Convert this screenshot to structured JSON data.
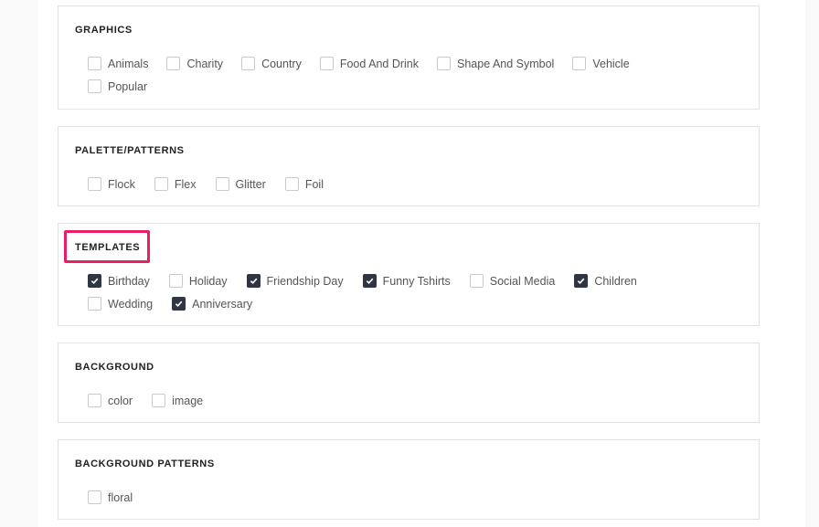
{
  "sections": [
    {
      "title": "GRAPHICS",
      "rows": [
        [
          {
            "label": "Animals",
            "checked": false
          },
          {
            "label": "Charity",
            "checked": false
          },
          {
            "label": "Country",
            "checked": false
          },
          {
            "label": "Food And Drink",
            "checked": false
          },
          {
            "label": "Shape And Symbol",
            "checked": false
          },
          {
            "label": "Vehicle",
            "checked": false
          }
        ],
        [
          {
            "label": "Popular",
            "checked": false
          }
        ]
      ]
    },
    {
      "title": "PALETTE/PATTERNS",
      "rows": [
        [
          {
            "label": "Flock",
            "checked": false
          },
          {
            "label": "Flex",
            "checked": false
          },
          {
            "label": "Glitter",
            "checked": false
          },
          {
            "label": "Foil",
            "checked": false
          }
        ]
      ]
    },
    {
      "title": "TEMPLATES",
      "highlighted": true,
      "rows": [
        [
          {
            "label": "Birthday",
            "checked": true
          },
          {
            "label": "Holiday",
            "checked": false
          },
          {
            "label": "Friendship Day",
            "checked": true
          },
          {
            "label": "Funny Tshirts",
            "checked": true
          },
          {
            "label": "Social Media",
            "checked": false
          },
          {
            "label": "Children",
            "checked": true
          }
        ],
        [
          {
            "label": "Wedding",
            "checked": false
          },
          {
            "label": "Anniversary",
            "checked": true
          }
        ]
      ]
    },
    {
      "title": "BACKGROUND",
      "rows": [
        [
          {
            "label": "color",
            "checked": false
          },
          {
            "label": "image",
            "checked": false
          }
        ]
      ]
    },
    {
      "title": "BACKGROUND PATTERNS",
      "rows": [
        [
          {
            "label": "floral",
            "checked": false
          }
        ]
      ]
    }
  ],
  "colors": {
    "highlight": "#e91e63",
    "checked": "#2f3542"
  }
}
